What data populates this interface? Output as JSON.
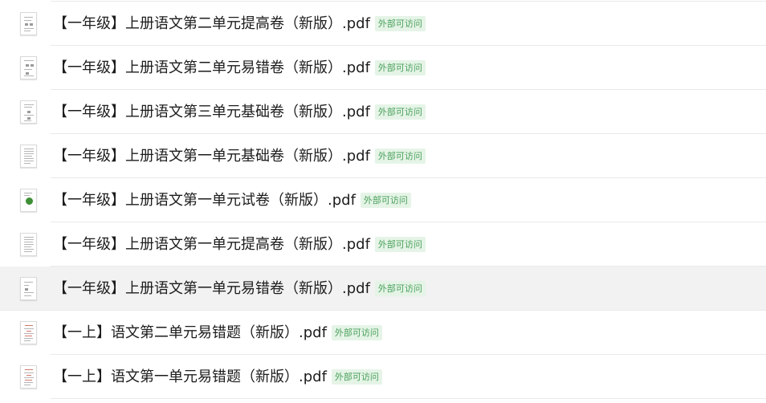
{
  "files": [
    {
      "name": "【一年级】上册语文第二单元提高卷（新版）.pdf",
      "badge": "外部可访问",
      "hover": false,
      "thumb": "doc-a"
    },
    {
      "name": "【一年级】上册语文第二单元易错卷（新版）.pdf",
      "badge": "外部可访问",
      "hover": false,
      "thumb": "doc-b"
    },
    {
      "name": "【一年级】上册语文第三单元基础卷（新版）.pdf",
      "badge": "外部可访问",
      "hover": false,
      "thumb": "doc-c"
    },
    {
      "name": "【一年级】上册语文第一单元基础卷（新版）.pdf",
      "badge": "外部可访问",
      "hover": false,
      "thumb": "doc-d"
    },
    {
      "name": "【一年级】上册语文第一单元试卷（新版）.pdf",
      "badge": "外部可访问",
      "hover": false,
      "thumb": "doc-green"
    },
    {
      "name": "【一年级】上册语文第一单元提高卷（新版）.pdf",
      "badge": "外部可访问",
      "hover": false,
      "thumb": "doc-e"
    },
    {
      "name": "【一年级】上册语文第一单元易错卷（新版）.pdf",
      "badge": "外部可访问",
      "hover": true,
      "thumb": "doc-f"
    },
    {
      "name": "【一上】语文第二单元易错题（新版）.pdf",
      "badge": "外部可访问",
      "hover": false,
      "thumb": "doc-red"
    },
    {
      "name": "【一上】语文第一单元易错题（新版）.pdf",
      "badge": "外部可访问",
      "hover": false,
      "thumb": "doc-red"
    }
  ],
  "colors": {
    "hover_background": "#f1f2f1",
    "badge_text": "#4aa05b",
    "badge_background": "#e5f4e7",
    "divider": "#e9e9e9"
  },
  "icons": {
    "file_thumbnail": "pdf-document-thumbnail-icon"
  }
}
